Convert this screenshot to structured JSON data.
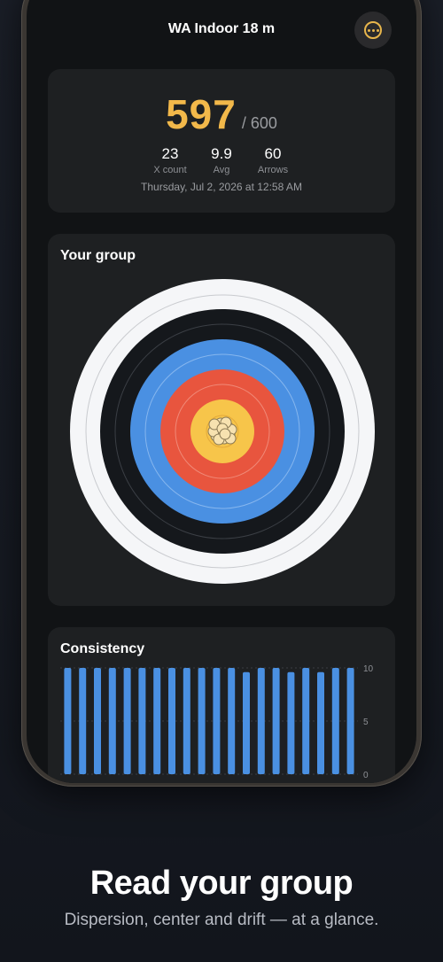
{
  "header": {
    "title": "WA Indoor 18 m",
    "more_icon": "ellipsis-circle-icon"
  },
  "score": {
    "total": "597",
    "max": "/ 600",
    "stats": [
      {
        "value": "23",
        "label": "X count"
      },
      {
        "value": "9.9",
        "label": "Avg"
      },
      {
        "value": "60",
        "label": "Arrows"
      }
    ],
    "date": "Thursday, Jul 2, 2026 at 12:58 AM"
  },
  "group": {
    "title": "Your group"
  },
  "consistency": {
    "title": "Consistency",
    "ticks": [
      "10",
      "5",
      "0"
    ]
  },
  "chart_data": {
    "type": "bar",
    "ylim": [
      0,
      10
    ],
    "yticks": [
      0,
      5,
      10
    ],
    "values": [
      10,
      10,
      10,
      10,
      10,
      10,
      10,
      10,
      10,
      10,
      10,
      10,
      9.6,
      10,
      10,
      9.6,
      10,
      9.6,
      10,
      10
    ],
    "color": "#4a90e2",
    "grid": true
  },
  "colors": {
    "accent": "#f2b84a",
    "gold": "#f7c54a",
    "red": "#e8553e",
    "blue": "#4a90e2",
    "black": "#15181c",
    "white": "#f5f6f8"
  },
  "marketing": {
    "headline": "Read your group",
    "subline": "Dispersion, center and drift — at a glance."
  }
}
